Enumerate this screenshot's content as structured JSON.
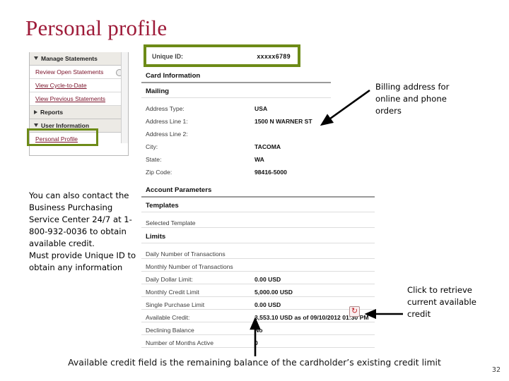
{
  "slide": {
    "title": "Personal profile",
    "page_number": "32",
    "caption": "Available credit field is the remaining balance of the cardholder’s existing credit limit",
    "accent_green": "#6d8b17",
    "title_color": "#9e1b39",
    "link_color": "#7a1229"
  },
  "sidebar": {
    "items": [
      {
        "label": "Manage Statements",
        "type": "header",
        "icon": "triangle-down-icon",
        "badge": false
      },
      {
        "label": "Review Open Statements",
        "type": "plain",
        "icon": "",
        "badge": true
      },
      {
        "label": "View Cycle-to-Date",
        "type": "link",
        "icon": "",
        "badge": false
      },
      {
        "label": "View Previous Statements",
        "type": "link",
        "icon": "",
        "badge": false
      },
      {
        "label": "Reports",
        "type": "header",
        "icon": "triangle-right-icon",
        "badge": false
      },
      {
        "label": "User Information",
        "type": "header",
        "icon": "triangle-down-icon",
        "badge": false
      },
      {
        "label": "Personal Profile",
        "type": "link",
        "icon": "",
        "badge": false
      }
    ]
  },
  "unique_id": {
    "label": "Unique ID:",
    "value": "xxxxx6789"
  },
  "card_information": {
    "section": "Card Information",
    "subsection": "Mailing",
    "fields": [
      {
        "label": "Address Type:",
        "value": "USA"
      },
      {
        "label": "Address Line 1:",
        "value": "1500 N WARNER ST"
      },
      {
        "label": "Address Line 2:",
        "value": ""
      },
      {
        "label": "City:",
        "value": "TACOMA"
      },
      {
        "label": "State:",
        "value": "WA"
      },
      {
        "label": "Zip Code:",
        "value": "98416-5000"
      }
    ]
  },
  "account_parameters": {
    "section": "Account Parameters",
    "templates_heading": "Templates",
    "templates_fields": [
      {
        "label": "Selected Template",
        "value": ""
      }
    ],
    "limits_heading": "Limits",
    "limits_fields": [
      {
        "label": "Daily Number of Transactions",
        "value": ""
      },
      {
        "label": "Monthly Number of Transactions",
        "value": ""
      },
      {
        "label": "Daily Dollar Limit:",
        "value": "0.00 USD"
      },
      {
        "label": "Monthly Credit Limit",
        "value": "5,000.00 USD"
      },
      {
        "label": "Single Purchase Limit",
        "value": "0.00 USD"
      },
      {
        "label": "Available Credit:",
        "value": "3,553.10 USD as of 09/10/2012 01:30 PM"
      },
      {
        "label": "Declining Balance",
        "value": "No"
      },
      {
        "label": "Number of Months Active",
        "value": "0"
      }
    ],
    "refresh_icon": "refresh-icon"
  },
  "callouts": {
    "billing": "Billing address for online and phone orders",
    "contact": "You can also contact the Business Purchasing Service Center 24/7 at 1-800-932-0036 to obtain available credit.\nMust provide Unique ID to obtain any information",
    "click": "Click to retrieve current available credit"
  }
}
